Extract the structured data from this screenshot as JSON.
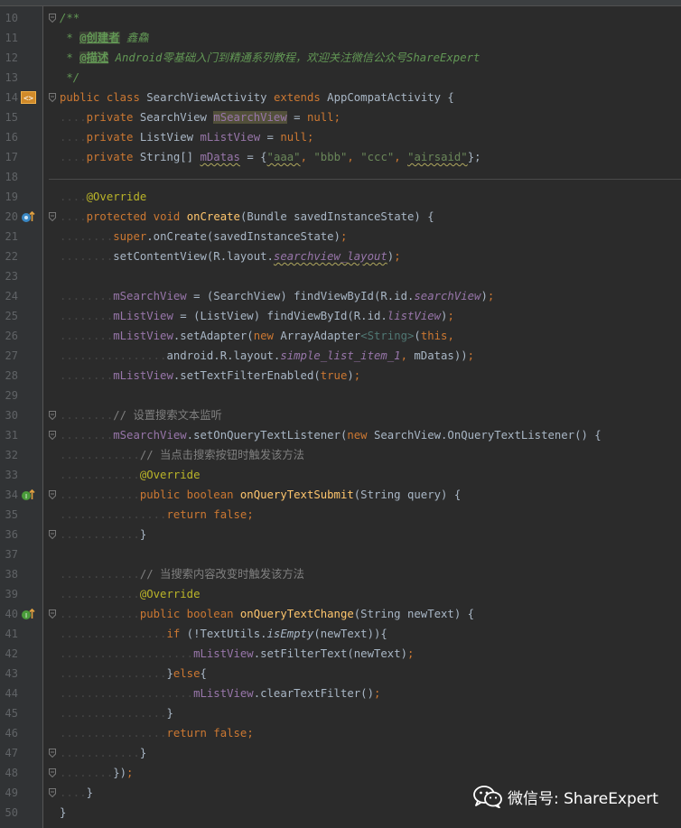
{
  "lines": [
    {
      "n": "10",
      "segs": [
        [
          "/**",
          "doc"
        ]
      ]
    },
    {
      "n": "11",
      "segs": [
        [
          " * ",
          "doc"
        ],
        [
          "@创建者",
          "tag"
        ],
        [
          " 鑫鱻",
          "doc"
        ]
      ]
    },
    {
      "n": "12",
      "segs": [
        [
          " * ",
          "doc"
        ],
        [
          "@描述",
          "tag"
        ],
        [
          " Android零基础入门到精通系列教程，欢迎关注微信公众号ShareExpert",
          "doc"
        ]
      ]
    },
    {
      "n": "13",
      "segs": [
        [
          " */",
          "doc"
        ]
      ]
    },
    {
      "n": "14",
      "segs": [
        [
          "public",
          "kw"
        ],
        [
          " ",
          "dot"
        ],
        [
          "class",
          "kw"
        ],
        [
          " SearchViewActivity ",
          ""
        ],
        [
          "extends",
          "kw"
        ],
        [
          " AppCompatActivity {",
          ""
        ]
      ]
    },
    {
      "n": "15",
      "segs": [
        [
          "....",
          "dot"
        ],
        [
          "private",
          "kw"
        ],
        [
          " SearchView ",
          ""
        ],
        [
          "mSearchView",
          "fld hl"
        ],
        [
          " = ",
          ""
        ],
        [
          "null",
          "kw"
        ],
        [
          ";",
          "kw"
        ]
      ]
    },
    {
      "n": "16",
      "segs": [
        [
          "....",
          "dot"
        ],
        [
          "private",
          "kw"
        ],
        [
          " ListView ",
          ""
        ],
        [
          "mListView",
          "fld"
        ],
        [
          " = ",
          ""
        ],
        [
          "null",
          "kw"
        ],
        [
          ";",
          "kw"
        ]
      ]
    },
    {
      "n": "17",
      "segs": [
        [
          "....",
          "dot"
        ],
        [
          "private",
          "kw"
        ],
        [
          " String[] ",
          ""
        ],
        [
          "mDatas",
          "fld sq"
        ],
        [
          " = {",
          ""
        ],
        [
          "\"aaa\"",
          "str sq"
        ],
        [
          ", ",
          "kw"
        ],
        [
          "\"bbb\"",
          "str"
        ],
        [
          ", ",
          "kw"
        ],
        [
          "\"ccc\"",
          "str"
        ],
        [
          ", ",
          "kw"
        ],
        [
          "\"airsaid\"",
          "str sq"
        ],
        [
          "};",
          ""
        ]
      ]
    },
    {
      "n": "18",
      "segs": []
    },
    {
      "n": "19",
      "segs": [
        [
          "....",
          "dot"
        ],
        [
          "@Override",
          "ann"
        ]
      ]
    },
    {
      "n": "20",
      "segs": [
        [
          "....",
          "dot"
        ],
        [
          "protected",
          "kw"
        ],
        [
          " ",
          ""
        ],
        [
          "void",
          "kw"
        ],
        [
          " ",
          ""
        ],
        [
          "onCreate",
          "fn"
        ],
        [
          "(Bundle savedInstanceState) {",
          ""
        ]
      ]
    },
    {
      "n": "21",
      "segs": [
        [
          "........",
          "dot"
        ],
        [
          "super",
          "kw"
        ],
        [
          ".onCreate(savedInstanceState)",
          ""
        ],
        [
          ";",
          "kw"
        ]
      ]
    },
    {
      "n": "22",
      "segs": [
        [
          "........",
          "dot"
        ],
        [
          "setContentView(R.layout.",
          ""
        ],
        [
          "searchview_layout",
          "fld it sq"
        ],
        [
          ")",
          ""
        ],
        [
          ";",
          "kw"
        ]
      ]
    },
    {
      "n": "23",
      "segs": []
    },
    {
      "n": "24",
      "segs": [
        [
          "........",
          "dot"
        ],
        [
          "mSearchView",
          "fld"
        ],
        [
          " = (SearchView) findViewById(R.id.",
          ""
        ],
        [
          "searchView",
          "fld it"
        ],
        [
          ")",
          ""
        ],
        [
          ";",
          "kw"
        ]
      ]
    },
    {
      "n": "25",
      "segs": [
        [
          "........",
          "dot"
        ],
        [
          "mListView",
          "fld"
        ],
        [
          " = (ListView) findViewById(R.id.",
          ""
        ],
        [
          "listView",
          "fld it"
        ],
        [
          ")",
          ""
        ],
        [
          ";",
          "kw"
        ]
      ]
    },
    {
      "n": "26",
      "segs": [
        [
          "........",
          "dot"
        ],
        [
          "mListView",
          "fld"
        ],
        [
          ".setAdapter(",
          ""
        ],
        [
          "new",
          "kw"
        ],
        [
          " ArrayAdapter",
          ""
        ],
        [
          "<String>",
          "gen"
        ],
        [
          "(",
          ""
        ],
        [
          "this",
          "kw"
        ],
        [
          ",",
          "kw"
        ]
      ]
    },
    {
      "n": "27",
      "segs": [
        [
          "................",
          "dot"
        ],
        [
          "android.R.layout.",
          ""
        ],
        [
          "simple_list_item_1",
          "fld it"
        ],
        [
          ", ",
          "kw"
        ],
        [
          "mDatas",
          ""
        ],
        [
          "))",
          ""
        ],
        [
          ";",
          "kw"
        ]
      ]
    },
    {
      "n": "28",
      "segs": [
        [
          "........",
          "dot"
        ],
        [
          "mListView",
          "fld"
        ],
        [
          ".setTextFilterEnabled(",
          ""
        ],
        [
          "true",
          "kw"
        ],
        [
          ")",
          ""
        ],
        [
          ";",
          "kw"
        ]
      ]
    },
    {
      "n": "29",
      "segs": []
    },
    {
      "n": "30",
      "segs": [
        [
          "........",
          "dot"
        ],
        [
          "// 设置搜索文本监听",
          "cm"
        ]
      ]
    },
    {
      "n": "31",
      "segs": [
        [
          "........",
          "dot"
        ],
        [
          "mSearchView",
          "fld"
        ],
        [
          ".setOnQueryTextListener(",
          ""
        ],
        [
          "new",
          "kw"
        ],
        [
          " SearchView.OnQueryTextListener() {",
          ""
        ]
      ]
    },
    {
      "n": "32",
      "segs": [
        [
          "............",
          "dot"
        ],
        [
          "// 当点击搜索按钮时触发该方法",
          "cm"
        ]
      ]
    },
    {
      "n": "33",
      "segs": [
        [
          "............",
          "dot"
        ],
        [
          "@Override",
          "ann"
        ]
      ]
    },
    {
      "n": "34",
      "segs": [
        [
          "............",
          "dot"
        ],
        [
          "public",
          "kw"
        ],
        [
          " ",
          ""
        ],
        [
          "boolean",
          "kw"
        ],
        [
          " ",
          ""
        ],
        [
          "onQueryTextSubmit",
          "fn"
        ],
        [
          "(String query) {",
          ""
        ]
      ]
    },
    {
      "n": "35",
      "segs": [
        [
          "................",
          "dot"
        ],
        [
          "return",
          "kw"
        ],
        [
          " ",
          ""
        ],
        [
          "false",
          "kw"
        ],
        [
          ";",
          "kw"
        ]
      ]
    },
    {
      "n": "36",
      "segs": [
        [
          "............",
          "dot"
        ],
        [
          "}",
          ""
        ]
      ]
    },
    {
      "n": "37",
      "segs": []
    },
    {
      "n": "38",
      "segs": [
        [
          "............",
          "dot"
        ],
        [
          "// 当搜索内容改变时触发该方法",
          "cm"
        ]
      ]
    },
    {
      "n": "39",
      "segs": [
        [
          "............",
          "dot"
        ],
        [
          "@Override",
          "ann"
        ]
      ]
    },
    {
      "n": "40",
      "segs": [
        [
          "............",
          "dot"
        ],
        [
          "public",
          "kw"
        ],
        [
          " ",
          ""
        ],
        [
          "boolean",
          "kw"
        ],
        [
          " ",
          ""
        ],
        [
          "onQueryTextChange",
          "fn"
        ],
        [
          "(String newText) {",
          ""
        ]
      ]
    },
    {
      "n": "41",
      "segs": [
        [
          "................",
          "dot"
        ],
        [
          "if",
          "kw"
        ],
        [
          " (!TextUtils.",
          ""
        ],
        [
          "isEmpty",
          "it"
        ],
        [
          "(newText)){",
          ""
        ]
      ]
    },
    {
      "n": "42",
      "segs": [
        [
          "....................",
          "dot"
        ],
        [
          "mListView",
          "fld"
        ],
        [
          ".setFilterText(newText)",
          ""
        ],
        [
          ";",
          "kw"
        ]
      ]
    },
    {
      "n": "43",
      "segs": [
        [
          "................",
          "dot"
        ],
        [
          "}",
          ""
        ],
        [
          "else",
          "kw"
        ],
        [
          "{",
          ""
        ]
      ]
    },
    {
      "n": "44",
      "segs": [
        [
          "....................",
          "dot"
        ],
        [
          "mListView",
          "fld"
        ],
        [
          ".clearTextFilter()",
          ""
        ],
        [
          ";",
          "kw"
        ]
      ]
    },
    {
      "n": "45",
      "segs": [
        [
          "................",
          "dot"
        ],
        [
          "}",
          ""
        ]
      ]
    },
    {
      "n": "46",
      "segs": [
        [
          "................",
          "dot"
        ],
        [
          "return",
          "kw"
        ],
        [
          " ",
          ""
        ],
        [
          "false",
          "kw"
        ],
        [
          ";",
          "kw"
        ]
      ]
    },
    {
      "n": "47",
      "segs": [
        [
          "............",
          "dot"
        ],
        [
          "}",
          ""
        ]
      ]
    },
    {
      "n": "48",
      "segs": [
        [
          "........",
          "dot"
        ],
        [
          "})",
          ""
        ],
        [
          ";",
          "kw"
        ]
      ]
    },
    {
      "n": "49",
      "segs": [
        [
          "....",
          "dot"
        ],
        [
          "}",
          ""
        ]
      ]
    },
    {
      "n": "50",
      "segs": [
        [
          "}",
          ""
        ]
      ]
    }
  ],
  "gutter_icons": {
    "14": "class-structure-icon",
    "20": "override-method-icon",
    "34": "implement-method-icon",
    "40": "implement-method-icon"
  },
  "fold_marks": [
    "10",
    "14",
    "20",
    "30",
    "31",
    "34",
    "36",
    "40",
    "47",
    "48",
    "49"
  ],
  "watermark": {
    "text": "微信号: ShareExpert"
  }
}
